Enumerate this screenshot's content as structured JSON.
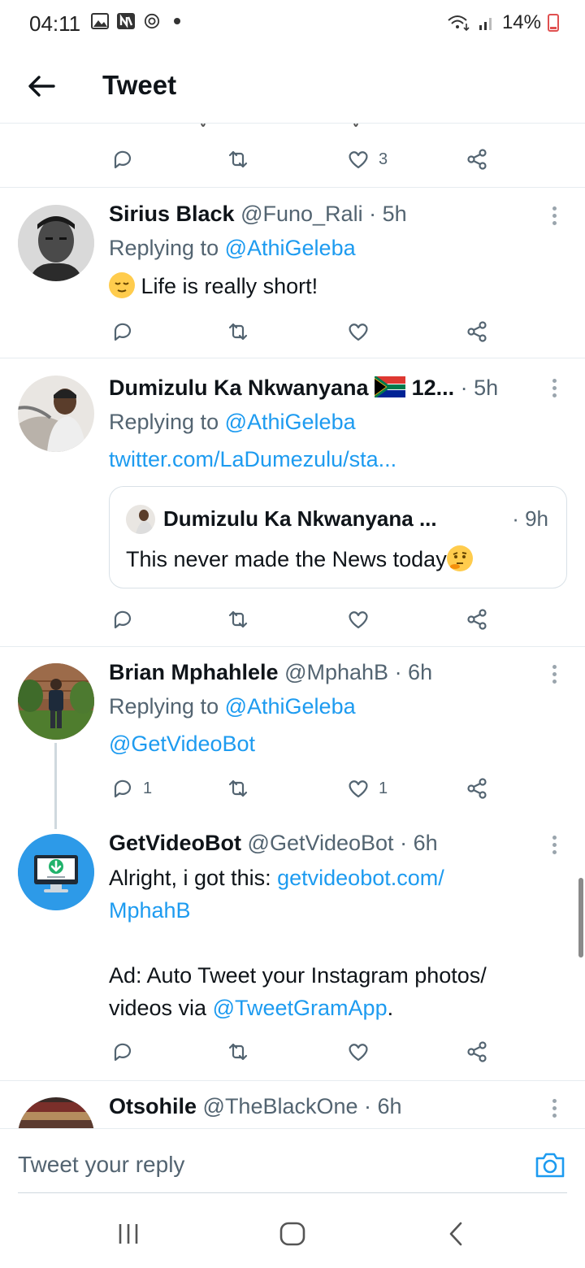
{
  "status_bar": {
    "time": "04:11",
    "battery": "14%"
  },
  "header": {
    "title": "Tweet"
  },
  "top_actions": {
    "like_count": "3"
  },
  "tweets": [
    {
      "name": "Sirius Black",
      "handle": "@Funo_Rali",
      "time": "· 5h",
      "replying_prefix": "Replying to",
      "replying_to": "@AthiGeleba",
      "text": "Life is really short!"
    },
    {
      "name": "Dumizulu Ka Nkwanyana",
      "name_suffix": "12...",
      "time": "· 5h",
      "replying_prefix": "Replying to",
      "replying_to": "@AthiGeleba",
      "link": "twitter.com/LaDumezulu/sta...",
      "quote": {
        "name": "Dumizulu Ka Nkwanyana ...",
        "time": "· 9h",
        "text": "This never made the News today"
      }
    },
    {
      "name": "Brian Mphahlele",
      "handle": "@MphahB",
      "time": "· 6h",
      "replying_prefix": "Replying to",
      "replying_to": "@AthiGeleba",
      "mention": "@GetVideoBot",
      "reply_count": "1",
      "like_count": "1"
    },
    {
      "name": "GetVideoBot",
      "handle": "@GetVideoBot",
      "time": "· 6h",
      "text_prefix": "Alright, i got this:",
      "link_line1": "getvideobot.com/",
      "link_line2": "MphahB",
      "ad_line1": "Ad: Auto Tweet your Instagram photos/",
      "ad_line2_prefix": "videos via",
      "ad_mention": "@TweetGramApp",
      "ad_period": "."
    },
    {
      "name": "Otsohile",
      "handle": "@TheBlackOne",
      "time": "· 6h"
    }
  ],
  "reply_bar": {
    "placeholder": "Tweet your reply"
  },
  "colors": {
    "accent": "#1d9bf0",
    "muted": "#536471",
    "text": "#0f1419"
  }
}
